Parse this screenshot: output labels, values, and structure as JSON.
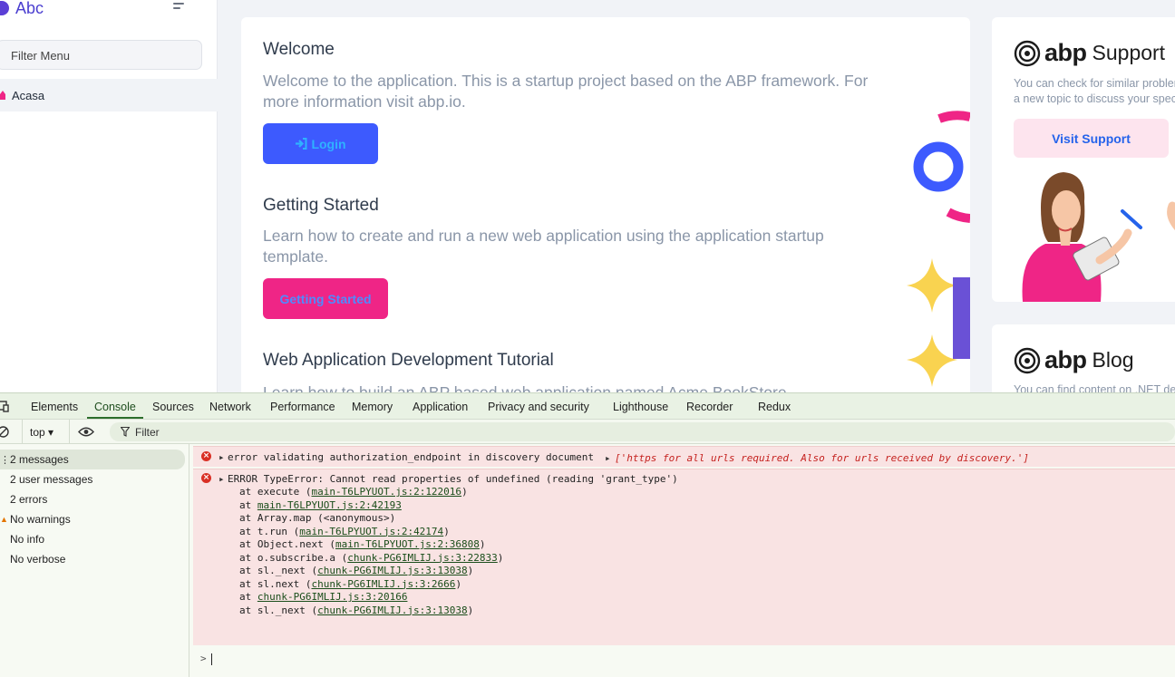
{
  "brand": {
    "name": "Abc"
  },
  "sidebar": {
    "filter_placeholder": "Filter Menu",
    "items": [
      {
        "label": "Acasa"
      }
    ]
  },
  "main": {
    "welcome": {
      "title": "Welcome",
      "text": "Welcome to the application. This is a startup project based on the ABP framework. For more information visit abp.io.",
      "button": "Login"
    },
    "getting_started": {
      "title": "Getting Started",
      "text": "Learn how to create and run a new web application using the application startup template.",
      "button": "Getting Started"
    },
    "tutorial": {
      "title": "Web Application Development Tutorial",
      "text": "Learn how to build an ABP based web application named Acme.BookStore."
    }
  },
  "right": {
    "support": {
      "logo_word": "abp",
      "label": "Support",
      "text_line1": "You can check for similar problems",
      "text_line2": "a new topic to discuss your specific",
      "button": "Visit Support"
    },
    "blog": {
      "logo_word": "abp",
      "label": "Blog",
      "text": "You can find content on .NET development"
    }
  },
  "devtools": {
    "tabs": [
      "Elements",
      "Console",
      "Sources",
      "Network",
      "Performance",
      "Memory",
      "Application",
      "Privacy and security",
      "Lighthouse",
      "Recorder",
      "Redux"
    ],
    "active_tab": "Console",
    "context": "top",
    "filter_placeholder": "Filter",
    "sidebar": [
      {
        "label": "2 messages",
        "icon": "list-icon"
      },
      {
        "label": "2 user messages",
        "icon": "user-icon"
      },
      {
        "label": "2 errors",
        "icon": "error-icon"
      },
      {
        "label": "No warnings",
        "icon": "warning-icon"
      },
      {
        "label": "No info",
        "icon": "info-icon"
      },
      {
        "label": "No verbose",
        "icon": "bug-icon"
      }
    ],
    "messages": [
      {
        "text": "error validating authorization_endpoint in discovery document",
        "detail": "['https for all urls required. Also for urls received by discovery.']"
      },
      {
        "text": "ERROR TypeError: Cannot read properties of undefined (reading 'grant_type')",
        "stack": [
          {
            "pre": "at execute (",
            "link": "main-T6LPYUOT.js:2:122016",
            "post": ")"
          },
          {
            "pre": "at ",
            "link": "main-T6LPYUOT.js:2:42193",
            "post": ""
          },
          {
            "pre": "at Array.map (<anonymous>)",
            "link": "",
            "post": ""
          },
          {
            "pre": "at t.run (",
            "link": "main-T6LPYUOT.js:2:42174",
            "post": ")"
          },
          {
            "pre": "at Object.next (",
            "link": "main-T6LPYUOT.js:2:36808",
            "post": ")"
          },
          {
            "pre": "at o.subscribe.a (",
            "link": "chunk-PG6IMLIJ.js:3:22833",
            "post": ")"
          },
          {
            "pre": "at sl._next (",
            "link": "chunk-PG6IMLIJ.js:3:13038",
            "post": ")"
          },
          {
            "pre": "at sl.next (",
            "link": "chunk-PG6IMLIJ.js:3:2666",
            "post": ")"
          },
          {
            "pre": "at ",
            "link": "chunk-PG6IMLIJ.js:3:20166",
            "post": ""
          },
          {
            "pre": "at sl._next (",
            "link": "chunk-PG6IMLIJ.js:3:13038",
            "post": ")"
          }
        ]
      }
    ],
    "prompt": ">"
  },
  "colors": {
    "primary": "#3d5afe",
    "pink": "#ef2586",
    "error_bg": "#f9e3e3",
    "devtools_green": "#e9f2e4"
  }
}
